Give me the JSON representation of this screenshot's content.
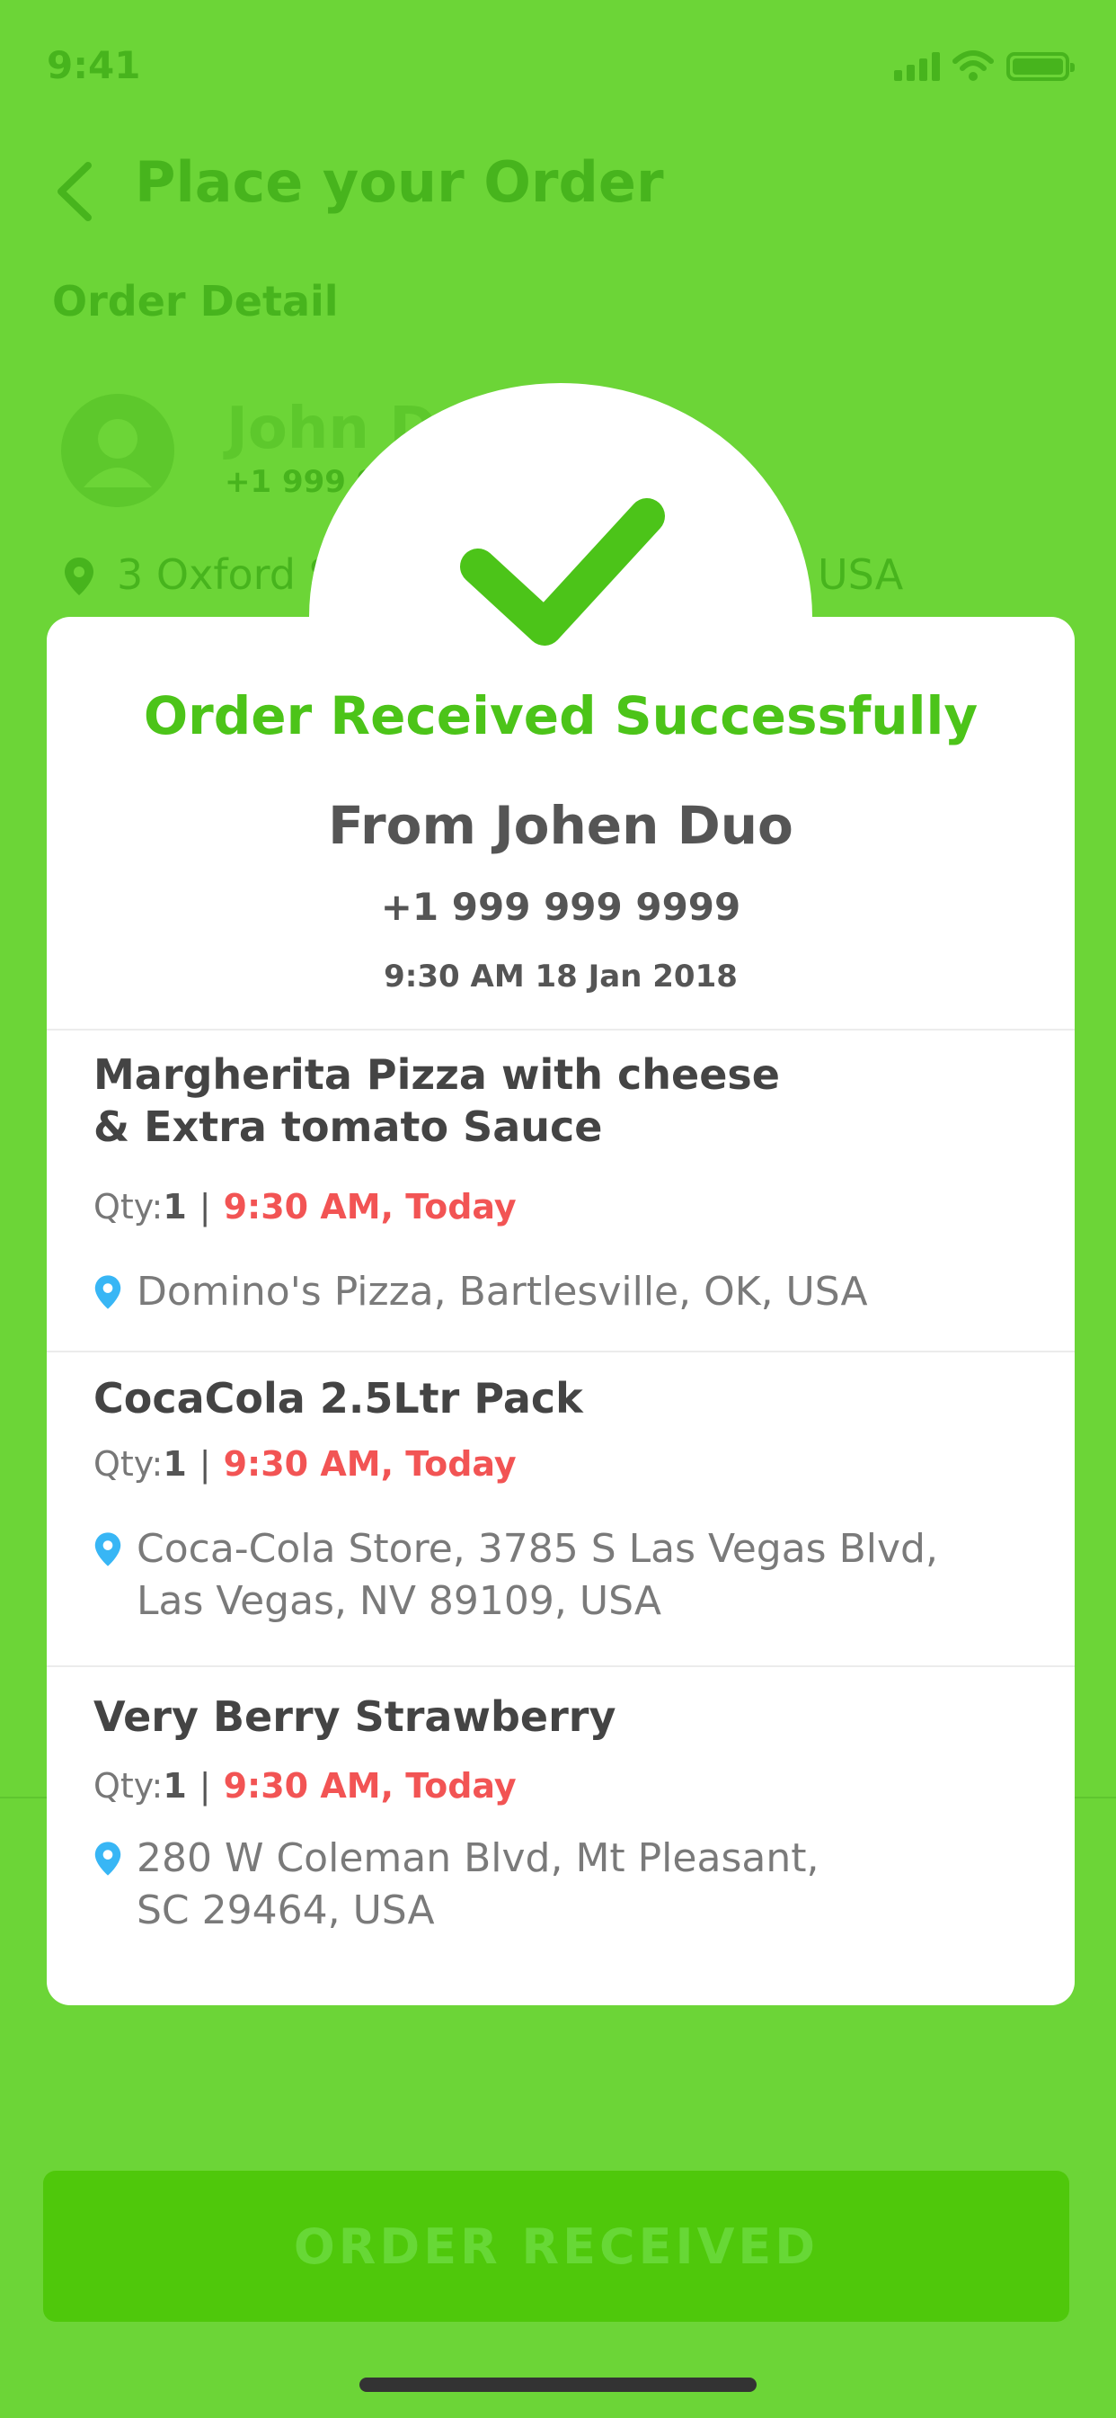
{
  "status_bar": {
    "time": "9:41"
  },
  "header": {
    "title": "Place your Order",
    "section": "Order Detail"
  },
  "background_order": {
    "name": "John D",
    "phone": "+1 999 9",
    "address_start": "3 Oxford S",
    "address_end": "USA"
  },
  "modal": {
    "title": "Order Received Successfully",
    "from": "From Johen Duo",
    "phone": "+1 999 999 9999",
    "datetime": "9:30 AM 18 Jan 2018",
    "qty_label": "Qty:",
    "items": [
      {
        "title": "Margherita Pizza with cheese\n& Extra tomato Sauce",
        "qty": "1",
        "time": "9:30 AM, Today",
        "address": "Domino's Pizza, Bartlesville, OK, USA"
      },
      {
        "title": "CocaCola 2.5Ltr Pack",
        "qty": "1",
        "time": "9:30 AM, Today",
        "address": "Coca-Cola Store,  3785 S Las Vegas Blvd,\nLas Vegas, NV 89109, USA"
      },
      {
        "title": "Very Berry Strawberry",
        "qty": "1",
        "time": "9:30 AM, Today",
        "address": "280 W Coleman Blvd, Mt Pleasant,\nSC 29464, USA"
      }
    ]
  },
  "button": {
    "label": "ORDER RECEIVED"
  },
  "colors": {
    "background": "#6cd537",
    "accent_green": "#4cc419",
    "time_red": "#f25454",
    "pin_blue": "#38b6f5"
  }
}
